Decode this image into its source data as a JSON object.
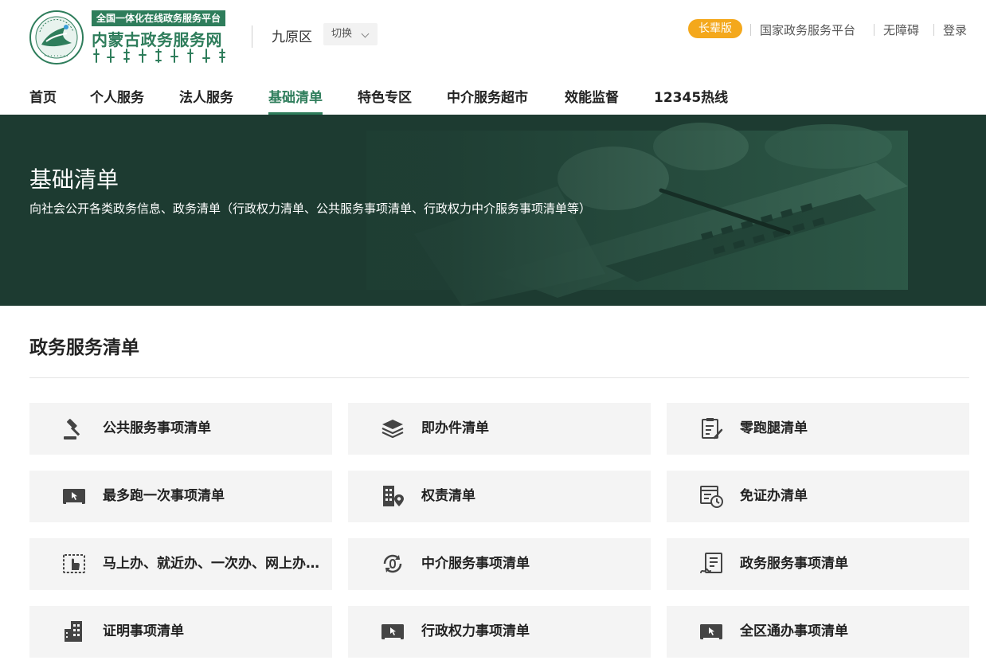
{
  "header": {
    "logo_tag": "全国一体化在线政务服务平台",
    "logo_title": "内蒙古政务服务网",
    "region": "九原区",
    "switch_label": "切换",
    "elder_mode": "长辈版",
    "links": [
      "国家政务服务平台",
      "无障碍",
      "登录"
    ]
  },
  "nav": {
    "items": [
      "首页",
      "个人服务",
      "法人服务",
      "基础清单",
      "特色专区",
      "中介服务超市",
      "效能监督",
      "12345热线"
    ],
    "active": "基础清单"
  },
  "banner": {
    "title": "基础清单",
    "subtitle": "向社会公开各类政务信息、政务清单（行政权力清单、公共服务事项清单、行政权力中介服务事项清单等）"
  },
  "section": {
    "title": "政务服务清单",
    "cards": [
      {
        "label": "公共服务事项清单",
        "icon": "gavel-icon"
      },
      {
        "label": "即办件清单",
        "icon": "layers-icon"
      },
      {
        "label": "零跑腿清单",
        "icon": "document-pen-icon"
      },
      {
        "label": "最多跑一次事项清单",
        "icon": "monitor-cursor-icon"
      },
      {
        "label": "权责清单",
        "icon": "building-location-icon"
      },
      {
        "label": "免证办清单",
        "icon": "document-clock-icon"
      },
      {
        "label": "马上办、就近办、一次办、网上办清单",
        "icon": "touch-hand-icon"
      },
      {
        "label": "中介服务事项清单",
        "icon": "circular-arrows-icon"
      },
      {
        "label": "政务服务事项清单",
        "icon": "document-sign-icon"
      },
      {
        "label": "证明事项清单",
        "icon": "buildings-icon"
      },
      {
        "label": "行政权力事项清单",
        "icon": "monitor-cursor-icon"
      },
      {
        "label": "全区通办事项清单",
        "icon": "monitor-cursor-icon"
      }
    ]
  },
  "colors": {
    "brand_green": "#2e7d5b",
    "banner_dark": "#1d3b31",
    "elder_orange": "#f4a81c",
    "card_bg": "#f4f4f4"
  }
}
